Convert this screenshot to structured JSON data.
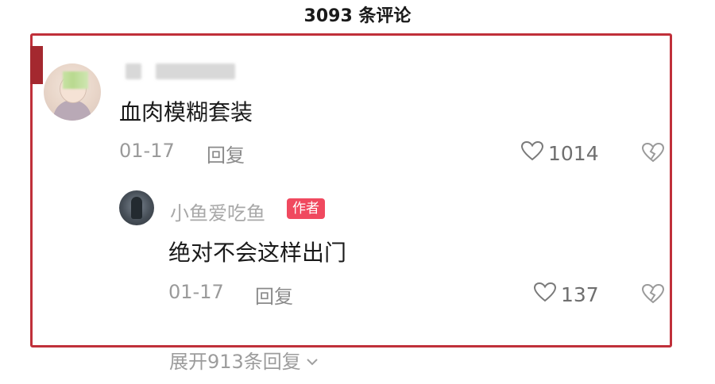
{
  "header": {
    "comment_count_title": "3093 条评论"
  },
  "comments": [
    {
      "text": "血肉模糊套装",
      "date": "01-17",
      "reply_label": "回复",
      "likes": "1014",
      "replies": [
        {
          "username": "小鱼爱吃鱼",
          "badge": "作者",
          "text": "绝对不会这样出门",
          "date": "01-17",
          "reply_label": "回复",
          "likes": "137"
        }
      ],
      "expand_label": "展开913条回复"
    }
  ],
  "colors": {
    "highlight_border": "#c0303a",
    "author_badge_bg": "#f0495f"
  },
  "icons": [
    "heart-icon",
    "broken-heart-icon",
    "chevron-down-icon"
  ]
}
